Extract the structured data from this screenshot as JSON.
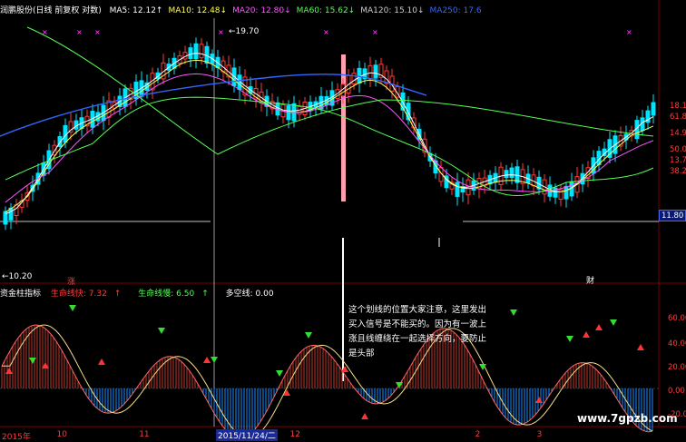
{
  "header": {
    "stock_title": "润鹏股份(日线 前复权 对数)",
    "ma": [
      {
        "label": "MA5: 12.12",
        "arrow": "↑",
        "color": "#ffffff"
      },
      {
        "label": "MA10: 12.48",
        "arrow": "↓",
        "color": "#ffff55"
      },
      {
        "label": "MA20: 12.80",
        "arrow": "↓",
        "color": "#ff55ff"
      },
      {
        "label": "MA60: 15.62",
        "arrow": "↓",
        "color": "#55ff55"
      },
      {
        "label": "MA120: 15.10",
        "arrow": "↓",
        "color": "#cccccc"
      },
      {
        "label": "MA250: 17.6",
        "arrow": "",
        "color": "#3366ff"
      }
    ]
  },
  "price_panel": {
    "high_label": "19.70",
    "low_label": "10.20",
    "current_price_tag": "11.80",
    "zhang_marker": "涨",
    "cai_marker": "财",
    "y_axis_labels": [
      "18.1",
      "61.8%",
      "14.9",
      "50.0",
      "13.7",
      "38.2%"
    ]
  },
  "indicator": {
    "name": "资金柱指标",
    "lifeline_fast_label": "生命线快: 7.32",
    "lifeline_fast_arrow": "↑",
    "lifeline_slow_label": "生命线慢: 6.50",
    "lifeline_slow_arrow": "↑",
    "long_short_label": "多空线: 0.00",
    "y_axis_labels": [
      "60.00",
      "40.00",
      "20.00",
      "0.00",
      "-20.0"
    ]
  },
  "annotation": {
    "lines": [
      "这个划线的位置大家注意，这里发出",
      "买入信号是不能买的。因为有一波上",
      "涨且线缠绕在一起选择方向，要防止",
      "是头部"
    ]
  },
  "time_axis": {
    "labels": [
      {
        "text": "2015年",
        "pos": 0.0
      },
      {
        "text": "10",
        "pos": 0.08
      },
      {
        "text": "11",
        "pos": 0.2
      },
      {
        "text": "12",
        "pos": 0.42
      },
      {
        "text": "2",
        "pos": 0.69
      },
      {
        "text": "3",
        "pos": 0.78
      }
    ],
    "cursor_date": "2015/11/24/二"
  },
  "watermark": "www.7gpzb.com",
  "colors": {
    "up": "#ff3b3b",
    "down": "#00e5ff",
    "axis_text": "#ff3b3b"
  }
}
